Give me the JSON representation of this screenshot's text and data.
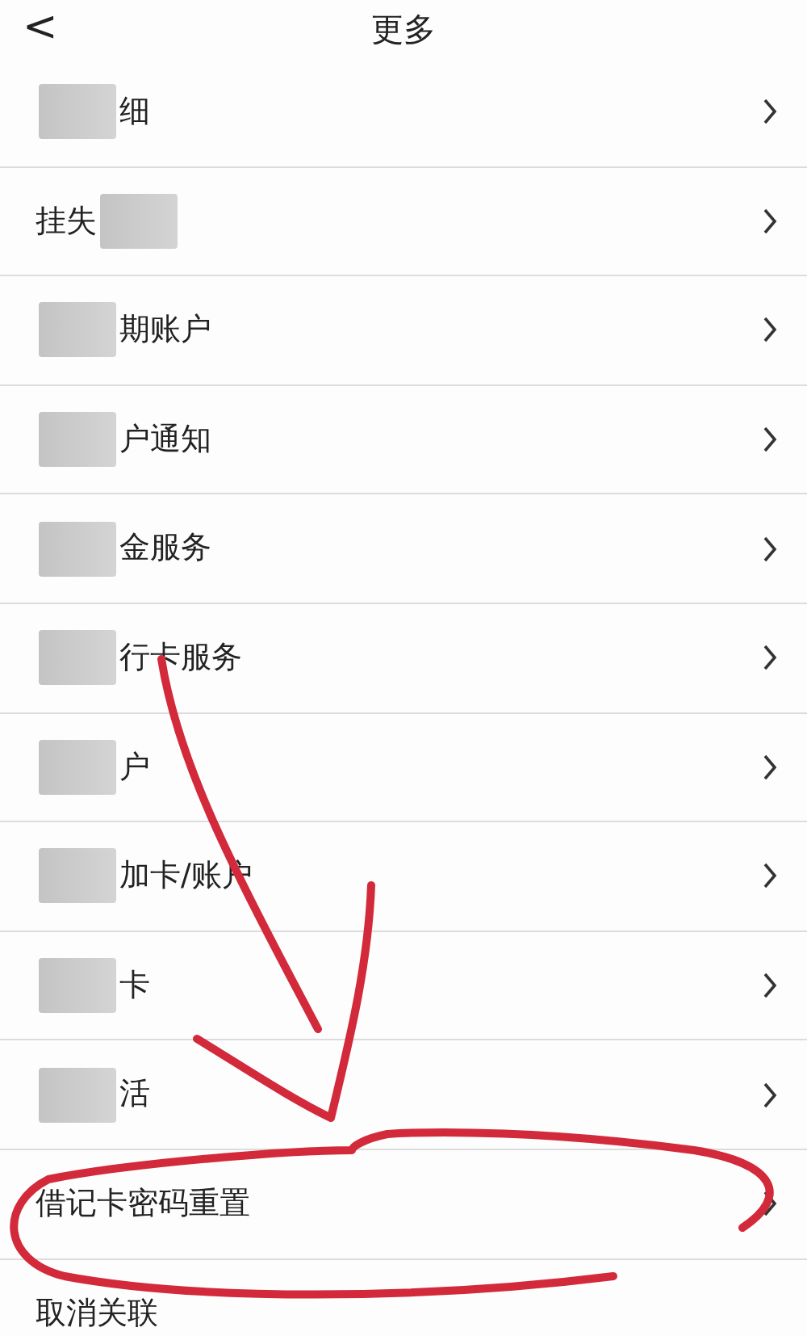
{
  "header": {
    "back": "<",
    "title": "更多"
  },
  "rows": [
    {
      "prefix": "",
      "obscured": true,
      "suffix": "细",
      "chevron": true
    },
    {
      "prefix": "挂失",
      "obscured": true,
      "suffix": "",
      "chevron": true
    },
    {
      "prefix": "",
      "obscured": true,
      "suffix": "期账户",
      "chevron": true
    },
    {
      "prefix": "",
      "obscured": true,
      "suffix": "户通知",
      "chevron": true
    },
    {
      "prefix": "",
      "obscured": true,
      "suffix": "金服务",
      "chevron": true
    },
    {
      "prefix": "",
      "obscured": true,
      "suffix": "行卡服务",
      "chevron": true
    },
    {
      "prefix": "",
      "obscured": true,
      "suffix": "户",
      "chevron": true
    },
    {
      "prefix": "",
      "obscured": true,
      "suffix": "加卡/账户",
      "chevron": true
    },
    {
      "prefix": "",
      "obscured": true,
      "suffix": "卡",
      "chevron": true
    },
    {
      "prefix": "",
      "obscured": true,
      "suffix": "活",
      "chevron": true
    },
    {
      "prefix": "借记卡密码重置",
      "obscured": false,
      "suffix": "",
      "chevron": true
    },
    {
      "prefix": "取消关联",
      "obscured": false,
      "suffix": "",
      "chevron": false
    }
  ]
}
